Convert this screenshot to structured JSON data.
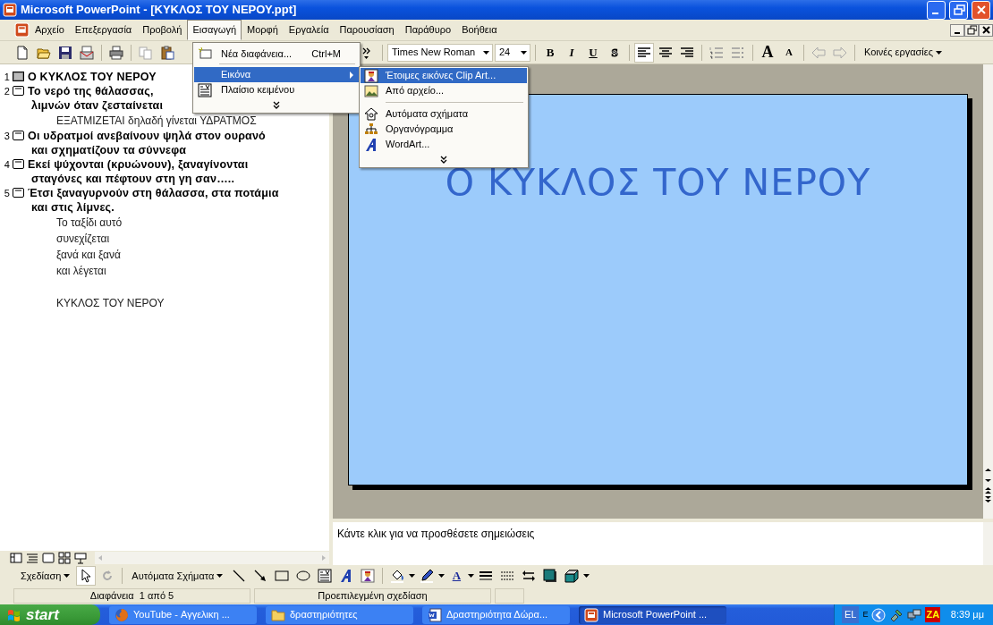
{
  "window": {
    "title": "Microsoft PowerPoint - [ΚΥΚΛΟΣ ΤΟΥ ΝΕΡΟΥ.ppt]"
  },
  "menu_bar": [
    {
      "label": "Αρχείο",
      "selected": false
    },
    {
      "label": "Επεξεργασία",
      "selected": false
    },
    {
      "label": "Προβολή",
      "selected": false
    },
    {
      "label": "Εισαγωγή",
      "selected": true
    },
    {
      "label": "Μορφή",
      "selected": false
    },
    {
      "label": "Εργαλεία",
      "selected": false
    },
    {
      "label": "Παρουσίαση",
      "selected": false
    },
    {
      "label": "Παράθυρο",
      "selected": false
    },
    {
      "label": "Βοήθεια",
      "selected": false
    }
  ],
  "insert_menu": [
    {
      "kind": "item",
      "label": "Νέα διαφάνεια...",
      "shortcut": "Ctrl+M",
      "selected": false
    },
    {
      "kind": "submenu",
      "label": "Εικόνα",
      "selected": true
    },
    {
      "kind": "item",
      "label": "Πλαίσιο κειμένου",
      "selected": false
    }
  ],
  "picture_submenu": [
    {
      "kind": "item",
      "label": "Έτοιμες εικόνες Clip Art...",
      "selected": true
    },
    {
      "kind": "item",
      "label": "Από αρχείο...",
      "selected": false
    },
    {
      "kind": "separator"
    },
    {
      "kind": "item",
      "label": "Αυτόματα σχήματα",
      "selected": false
    },
    {
      "kind": "item",
      "label": "Οργανόγραμμα",
      "selected": false
    },
    {
      "kind": "item",
      "label": "WordArt...",
      "selected": false
    }
  ],
  "toolbar": {
    "font": "Times New Roman",
    "size": "24",
    "format_buttons": [
      "B",
      "I",
      "U",
      "S"
    ],
    "font_size_buttons": [
      "A",
      "A"
    ],
    "tasks": "Κοινές εργασίες"
  },
  "outline": [
    {
      "number": "1",
      "selected": true,
      "lines": [
        "Ο ΚΥΚΛΟΣ ΤΟΥ ΝΕΡΟΥ"
      ]
    },
    {
      "number": "2",
      "selected": false,
      "lines": [
        "Το νερό της θάλασσας,",
        "λιμνών όταν ζεσταίνεται"
      ],
      "body": [
        {
          "text": "ΕΞΑΤΜΙΖΕΤΑΙ δηλαδή γίνεται ΥΔΡΑΤΜΟΣ",
          "blank_line_before": false
        }
      ]
    },
    {
      "number": "3",
      "selected": false,
      "lines": [
        "Οι υδρατμοί ανεβαίνουν ψηλά στον ουρανό",
        "και σχηματίζουν τα σύννεφα"
      ]
    },
    {
      "number": "4",
      "selected": false,
      "lines": [
        "Εκεί ψύχονται (κρυώνουν), ξαναγίνονται",
        "σταγόνες και πέφτουν στη γη σαν….."
      ]
    },
    {
      "number": "5",
      "selected": false,
      "lines": [
        "Έτσι ξαναγυρνούν στη θάλασσα, στα ποτάμια",
        "και στις λίμνες."
      ],
      "body": [
        {
          "text": "Το ταξίδι αυτό",
          "blank_line_before": false
        },
        {
          "text": "συνεχίζεται",
          "blank_line_before": false
        },
        {
          "text": "ξανά και ξανά",
          "blank_line_before": false
        },
        {
          "text": "και λέγεται",
          "blank_line_before": false
        },
        {
          "text": "ΚΥΚΛΟΣ ΤΟΥ ΝΕΡΟΥ",
          "blank_line_before": true
        }
      ]
    }
  ],
  "slide": {
    "title": "Ο ΚΥΚΛΟΣ ΤΟΥ ΝΕΡΟΥ"
  },
  "notes": {
    "prompt": "Κάντε κλικ για να προσθέσετε σημειώσεις"
  },
  "drawing_toolbar": {
    "draw": "Σχεδίαση",
    "autoshapes": "Αυτόματα Σχήματα",
    "font_color_label": "A"
  },
  "status_bar": {
    "slide": "Διαφάνεια  1 από 5",
    "design": "Προεπιλεγμένη σχεδίαση"
  },
  "taskbar": {
    "start": "start",
    "tasks": [
      {
        "kind": "browser",
        "label": "YouTube - Αγγελικη ...",
        "selected": false
      },
      {
        "kind": "folder",
        "label": "δραστηριότητες",
        "selected": false
      },
      {
        "kind": "document",
        "label": "Δραστηριότητα Δώρα...",
        "selected": false
      },
      {
        "kind": "presentation",
        "label": "Microsoft PowerPoint ...",
        "selected": true
      }
    ],
    "language": "EL",
    "tray_letter": "E",
    "tray_badge": "ZA",
    "clock": "8:39 μμ"
  }
}
